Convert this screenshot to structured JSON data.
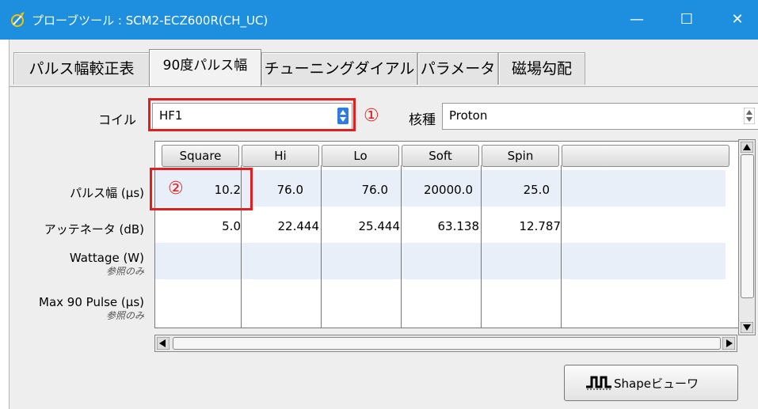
{
  "window": {
    "title": "プローブツール : SCM2-ECZ600R(CH_UC)",
    "controls": [
      "—",
      "☐",
      "✕"
    ]
  },
  "tabs": [
    {
      "label": "パルス幅較正表"
    },
    {
      "label": "90度パルス幅"
    },
    {
      "label": "チューニングダイアル"
    },
    {
      "label": "パラメータ"
    },
    {
      "label": "磁場勾配"
    }
  ],
  "coil": {
    "label": "コイル",
    "value": "HF1"
  },
  "nucleus": {
    "label": "核種",
    "value": "Proton"
  },
  "callouts": {
    "one": "①",
    "two": "②"
  },
  "table": {
    "columns": [
      "Square",
      "Hi",
      "Lo",
      "Soft",
      "Spin",
      ""
    ],
    "rows": [
      {
        "label": "パルス幅 (μs)",
        "sub": "",
        "values": [
          "10.2",
          "76.0",
          "76.0",
          "20000.0",
          "25.0"
        ]
      },
      {
        "label": "アッテネータ (dB)",
        "sub": "",
        "values": [
          "5.0",
          "22.444",
          "25.444",
          "63.138",
          "12.787"
        ]
      },
      {
        "label": "Wattage (W)",
        "sub": "参照のみ",
        "values": [
          "",
          "",
          "",
          "",
          ""
        ]
      },
      {
        "label": "Max 90 Pulse (μs)",
        "sub": "参照のみ",
        "values": [
          "",
          "",
          "",
          "",
          ""
        ]
      }
    ]
  },
  "shape_viewer_button": {
    "label": "Shapeビューワ"
  },
  "colors": {
    "titlebar": "#1e8fdf",
    "highlight": "#e02020",
    "row_alt": "#e9eff9"
  }
}
